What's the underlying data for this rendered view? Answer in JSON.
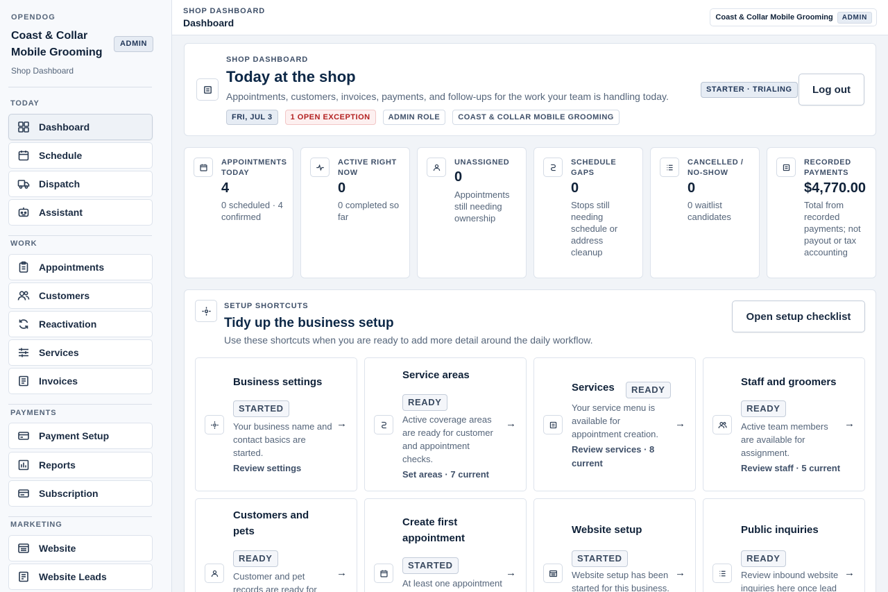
{
  "sidebar": {
    "brand": "OPENDOG",
    "business_name": "Coast & Collar Mobile Grooming",
    "role_badge": "ADMIN",
    "subtitle": "Shop Dashboard",
    "sections": [
      {
        "label": "TODAY",
        "items": [
          {
            "label": "Dashboard",
            "icon": "dashboard-icon"
          },
          {
            "label": "Schedule",
            "icon": "calendar-icon"
          },
          {
            "label": "Dispatch",
            "icon": "truck-icon"
          },
          {
            "label": "Assistant",
            "icon": "assistant-icon"
          }
        ]
      },
      {
        "label": "WORK",
        "items": [
          {
            "label": "Appointments",
            "icon": "clipboard-icon"
          },
          {
            "label": "Customers",
            "icon": "users-icon"
          },
          {
            "label": "Reactivation",
            "icon": "refresh-icon"
          },
          {
            "label": "Services",
            "icon": "sliders-icon"
          },
          {
            "label": "Invoices",
            "icon": "invoice-icon"
          }
        ]
      },
      {
        "label": "PAYMENTS",
        "items": [
          {
            "label": "Payment Setup",
            "icon": "credit-card-icon"
          },
          {
            "label": "Reports",
            "icon": "bar-chart-icon"
          },
          {
            "label": "Subscription",
            "icon": "subscription-icon"
          }
        ]
      },
      {
        "label": "MARKETING",
        "items": [
          {
            "label": "Website",
            "icon": "website-icon"
          },
          {
            "label": "Website Leads",
            "icon": "leads-icon"
          }
        ]
      }
    ]
  },
  "topbar": {
    "eyebrow": "SHOP DASHBOARD",
    "title": "Dashboard",
    "account_name": "Coast & Collar Mobile Grooming",
    "account_role": "ADMIN"
  },
  "hero": {
    "eyebrow": "SHOP DASHBOARD",
    "title": "Today at the shop",
    "subtitle": "Appointments, customers, invoices, payments, and follow-ups for the work your team is handling today.",
    "chips": {
      "date": "FRI, JUL 3",
      "exception": "1 OPEN EXCEPTION",
      "role": "ADMIN ROLE",
      "business": "COAST & COLLAR MOBILE GROOMING"
    },
    "plan_badge": "STARTER · TRIALING",
    "logout_label": "Log out"
  },
  "stats": [
    {
      "label": "Appointments today",
      "value": "4",
      "desc": "0 scheduled · 4 confirmed",
      "icon": "calendar-icon"
    },
    {
      "label": "Active right now",
      "value": "0",
      "desc": "0 completed so far",
      "icon": "activity-icon"
    },
    {
      "label": "Unassigned",
      "value": "0",
      "desc": "Appointments still needing ownership",
      "icon": "user-icon"
    },
    {
      "label": "Schedule gaps",
      "value": "0",
      "desc": "Stops still needing schedule or address cleanup",
      "icon": "route-icon"
    },
    {
      "label": "Cancelled / no-show",
      "value": "0",
      "desc": "0 waitlist candidates",
      "icon": "list-icon"
    },
    {
      "label": "Recorded payments",
      "value": "$4,770.00",
      "desc": "Total from recorded payments; not payout or tax accounting",
      "icon": "receipt-icon"
    }
  ],
  "setup": {
    "eyebrow": "SETUP SHORTCUTS",
    "title": "Tidy up the business setup",
    "subtitle": "Use these shortcuts when you are ready to add more detail around the daily workflow.",
    "checklist_button": "Open setup checklist",
    "tiles": [
      {
        "title": "Business settings",
        "status": "STARTED",
        "desc": "Your business name and contact basics are started.",
        "link": "Review settings",
        "icon": "settings-icon"
      },
      {
        "title": "Service areas",
        "status": "READY",
        "desc": "Active coverage areas are ready for customer and appointment checks.",
        "link": "Set areas · 7 current",
        "icon": "route-icon"
      },
      {
        "title": "Services",
        "status": "READY",
        "desc": "Your service menu is available for appointment creation.",
        "link": "Review services · 8 current",
        "icon": "receipt-icon"
      },
      {
        "title": "Staff and groomers",
        "status": "READY",
        "desc": "Active team members are available for assignment.",
        "link": "Review staff · 5 current",
        "icon": "users-icon"
      },
      {
        "title": "Customers and pets",
        "status": "READY",
        "desc": "Customer and pet records are ready for",
        "link": "",
        "icon": "user-icon"
      },
      {
        "title": "Create first appointment",
        "status": "STARTED",
        "desc": "At least one appointment",
        "link": "",
        "icon": "calendar-icon"
      },
      {
        "title": "Website setup",
        "status": "STARTED",
        "desc": "Website setup has been started for this business.",
        "link": "",
        "icon": "website-icon"
      },
      {
        "title": "Public inquiries",
        "status": "READY",
        "desc": "Review inbound website inquiries here once lead",
        "link": "",
        "icon": "list-icon"
      }
    ]
  }
}
